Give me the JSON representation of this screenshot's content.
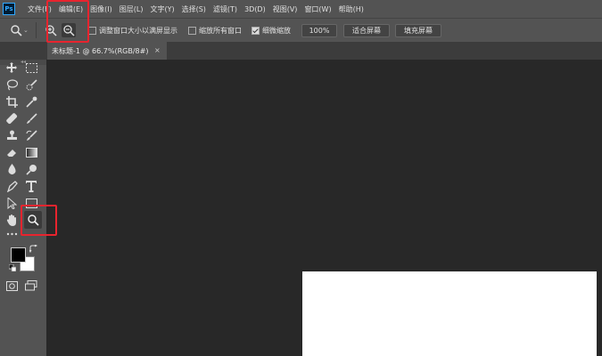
{
  "app": {
    "logo_text": "Ps"
  },
  "menu": {
    "items": [
      {
        "label": "文件(F)"
      },
      {
        "label": "编辑(E)"
      },
      {
        "label": "图像(I)"
      },
      {
        "label": "图层(L)"
      },
      {
        "label": "文字(Y)"
      },
      {
        "label": "选择(S)"
      },
      {
        "label": "滤镜(T)"
      },
      {
        "label": "3D(D)"
      },
      {
        "label": "视图(V)"
      },
      {
        "label": "窗口(W)"
      },
      {
        "label": "帮助(H)"
      }
    ]
  },
  "options": {
    "tool_icon": "zoom-icon",
    "zoom_in_icon": "zoom-in-icon",
    "zoom_out_icon": "zoom-out-icon",
    "resize_windows_label": "调整窗口大小以满屏显示",
    "resize_windows_checked": false,
    "zoom_all_windows_label": "缩放所有窗口",
    "zoom_all_windows_checked": false,
    "scrubby_zoom_label": "细微缩放",
    "scrubby_zoom_checked": true,
    "actual_pixels_label": "100%",
    "fit_screen_label": "适合屏幕",
    "fill_screen_label": "填充屏幕"
  },
  "document_tab": {
    "title": "未标题-1 @ 66.7%(RGB/8#)",
    "close_glyph": "×"
  },
  "toolbar": {
    "grip": "◂◂",
    "tools": [
      "move-icon",
      "marquee-icon",
      "lasso-icon",
      "quick-select-icon",
      "crop-icon",
      "eyedropper-icon",
      "healing-icon",
      "brush-icon",
      "stamp-icon",
      "history-brush-icon",
      "eraser-icon",
      "gradient-icon",
      "blur-icon",
      "dodge-icon",
      "pen-icon",
      "type-icon",
      "path-select-icon",
      "rectangle-icon",
      "hand-icon",
      "zoom-icon",
      "more-tools-icon",
      "quick-mask-icon",
      "screen-mode-icon"
    ],
    "foreground_color": "#000000",
    "background_color": "#ffffff"
  },
  "colors": {
    "highlight": "#e8242e",
    "panel": "#535353",
    "workspace": "#282828"
  }
}
